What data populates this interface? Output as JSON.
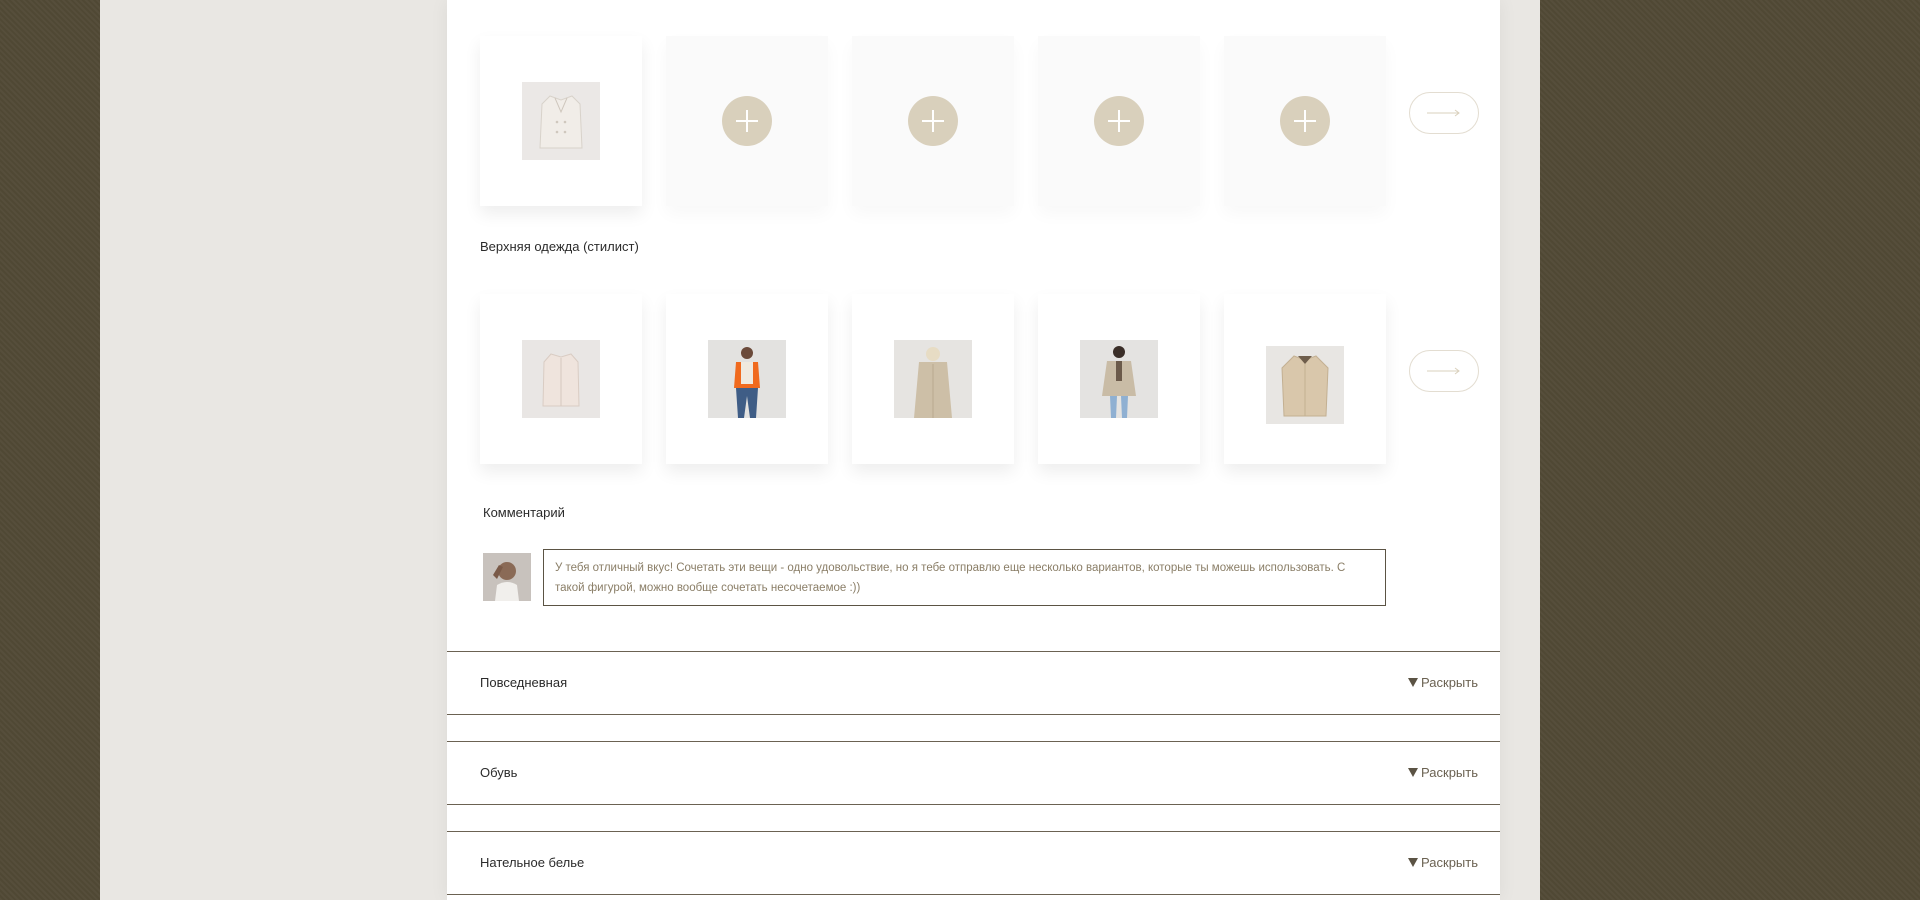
{
  "sections": {
    "outerwear_stylist_label": "Верхняя одежда (стилист)",
    "comment_label": "Комментарий"
  },
  "user_row": {
    "items": [
      {
        "icon": "beige-coat-thumbnail"
      },
      {
        "icon": "plus-icon"
      },
      {
        "icon": "plus-icon"
      },
      {
        "icon": "plus-icon"
      },
      {
        "icon": "plus-icon"
      }
    ],
    "next_icon": "arrow-right-icon"
  },
  "stylist_row": {
    "items": [
      {
        "icon": "beige-jacket-thumbnail"
      },
      {
        "icon": "orange-vest-look-thumbnail"
      },
      {
        "icon": "camel-coat-back-thumbnail"
      },
      {
        "icon": "trench-coat-look-thumbnail"
      },
      {
        "icon": "beige-shirt-jacket-thumbnail"
      }
    ],
    "next_icon": "arrow-right-icon"
  },
  "comment": {
    "text": "У тебя отличный вкус! Сочетать эти вещи - одно удовольствие, но я тебе отправлю еще несколько вариантов, которые ты можешь использовать. С такой фигурой, можно вообще сочетать несочетаемое :))"
  },
  "accordions": [
    {
      "title": "Повседневная",
      "toggle": "Раскрыть"
    },
    {
      "title": "Обувь",
      "toggle": "Раскрыть"
    },
    {
      "title": "Нательное белье",
      "toggle": "Раскрыть"
    }
  ],
  "colors": {
    "page_background": "#524a36",
    "outer_background": "#e9e7e3",
    "panel_background": "#ffffff",
    "accent_plus": "#d9d0bc",
    "border": "#6b6252",
    "comment_text": "#8a7e67"
  }
}
